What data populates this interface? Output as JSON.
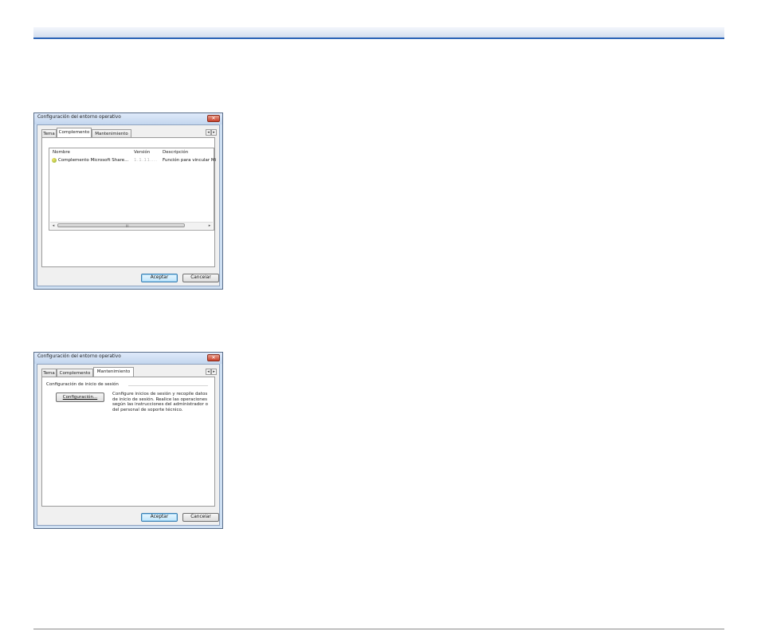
{
  "dialog1": {
    "title": "Configuración del entorno operativo",
    "close": "✕",
    "tabs": [
      "Tema",
      "Complemento",
      "Mantenimiento"
    ],
    "tab_arrows": [
      "◂",
      "▸"
    ],
    "list": {
      "columns": [
        "Nombre",
        "Versión",
        "Descripción"
      ],
      "rows": [
        {
          "name": "Complemento Microsoft Share...",
          "version": "1.1.11....",
          "description": "Función para vincular Mi"
        }
      ],
      "scroll_left": "◂",
      "scroll_right": "▸",
      "grip": "III"
    },
    "ok": "Aceptar",
    "cancel": "Cancelar"
  },
  "dialog2": {
    "title": "Configuración del entorno operativo",
    "close": "✕",
    "tabs": [
      "Tema",
      "Complemento",
      "Mantenimiento"
    ],
    "tab_arrows": [
      "◂",
      "▸"
    ],
    "group_label": "Configuración de inicio de sesión",
    "config_button": "Configuración...",
    "description": "Configure inicios de sesión y recopile datos de inicio de sesión. Realice las operaciones según las instrucciones del administrador o del personal de soporte técnico.",
    "ok": "Aceptar",
    "cancel": "Cancelar"
  }
}
